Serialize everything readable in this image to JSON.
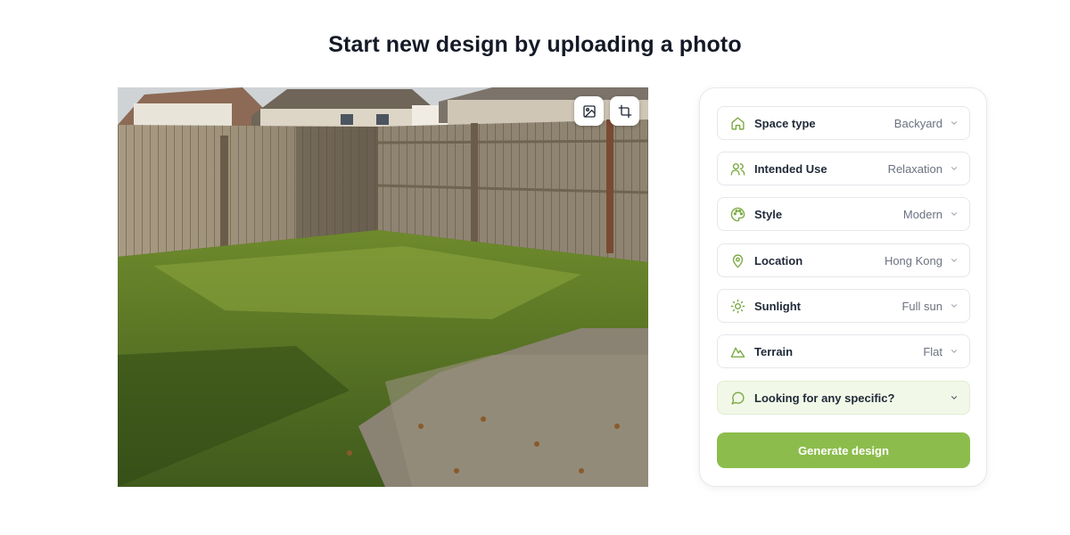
{
  "title": "Start new design by uploading a photo",
  "photo": {
    "alt": "Backyard with wooden fence, grass and concrete patio",
    "tools": [
      {
        "icon": "image-icon"
      },
      {
        "icon": "crop-icon"
      }
    ]
  },
  "settings": {
    "fields": [
      {
        "icon": "home-icon",
        "label": "Space type",
        "value": "Backyard"
      },
      {
        "icon": "users-icon",
        "label": "Intended Use",
        "value": "Relaxation"
      },
      {
        "icon": "palette-icon",
        "label": "Style",
        "value": "Modern"
      },
      {
        "icon": "map-pin-icon",
        "label": "Location",
        "value": "Hong Kong"
      },
      {
        "icon": "sun-icon",
        "label": "Sunlight",
        "value": "Full sun"
      },
      {
        "icon": "mountain-icon",
        "label": "Terrain",
        "value": "Flat"
      }
    ],
    "specific": {
      "icon": "message-circle-icon",
      "label": "Looking for any specific?"
    },
    "generate_label": "Generate design"
  },
  "colors": {
    "accent": "#8cbd4c",
    "icon": "#7cab45",
    "specific_bg": "#f2f8e8"
  }
}
